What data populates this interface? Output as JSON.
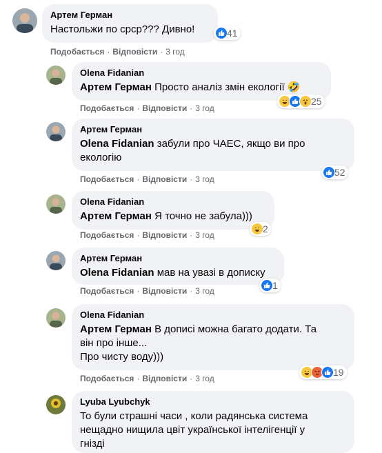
{
  "comments": [
    {
      "author": "Артем Герман",
      "mention": "",
      "text": "Настольжи по срср??? Дивно!",
      "reactions": [
        "like-icon"
      ],
      "count": "41",
      "like_label": "Подобається",
      "reply_label": "Відповісти",
      "time": "3 год"
    },
    {
      "author": "Olena Fidanian",
      "mention": "Артем Герман",
      "text": "Просто аналіз змін екології 🤣",
      "reactions": [
        "haha-icon",
        "like-icon",
        "wow-icon"
      ],
      "count": "25",
      "like_label": "Подобається",
      "reply_label": "Відповісти",
      "time": "3 год"
    },
    {
      "author": "Артем Герман",
      "mention": "Olena Fidanian",
      "text": "забули про ЧАЕС, якщо ви про\nекологію",
      "reactions": [
        "like-icon"
      ],
      "count": "52",
      "like_label": "Подобається",
      "reply_label": "Відповісти",
      "time": "3 год"
    },
    {
      "author": "Olena Fidanian",
      "mention": "Артем Герман",
      "text": "Я точно не забула)))",
      "reactions": [
        "haha-icon"
      ],
      "count": "2",
      "like_label": "Подобається",
      "reply_label": "Відповісти",
      "time": "3 год"
    },
    {
      "author": "Артем Герман",
      "mention": "Olena Fidanian",
      "text": "мав на увазі в дописку",
      "reactions": [
        "like-icon"
      ],
      "count": "1",
      "like_label": "Подобається",
      "reply_label": "Відповісти",
      "time": "3 год"
    },
    {
      "author": "Olena Fidanian",
      "mention": "Артем Герман",
      "text": "В дописі можна багато додати. Та\nвін про інше...\nПро чисту воду)))",
      "reactions": [
        "haha-icon",
        "angry-icon",
        "like-icon"
      ],
      "count": "19",
      "like_label": "Подобається",
      "reply_label": "Відповісти",
      "time": "3 год"
    },
    {
      "author": "Lyuba Lyubchyk",
      "mention": "",
      "text": "То були страшні часи , коли радянська система\nнещадно нищила цвіт української інтелігенції у\nгнізді",
      "reactions": [],
      "count": "",
      "like_label": "",
      "reply_label": "",
      "time": ""
    }
  ],
  "colors": {
    "bubble": "#f0f2f5",
    "like": "#1877f2",
    "meta": "#65676b"
  }
}
